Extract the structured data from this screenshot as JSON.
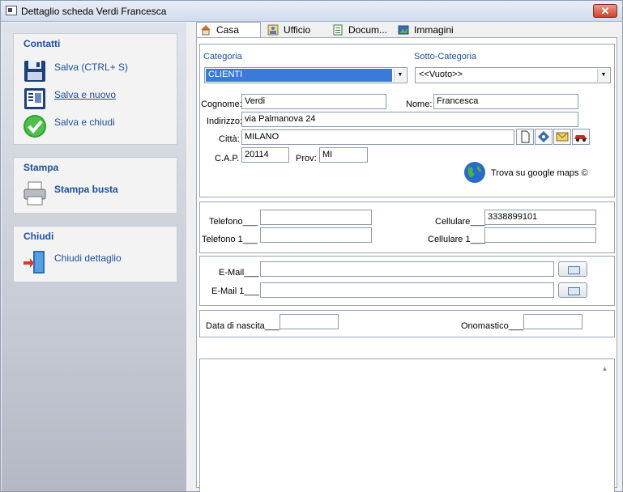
{
  "window": {
    "title": "Dettaglio scheda Verdi Francesca"
  },
  "sidebar": {
    "contatti": {
      "title": "Contatti",
      "save": "Salva (CTRL+ S)",
      "save_new": "Salva e nuovo",
      "save_close": "Salva e chiudi"
    },
    "stampa": {
      "title": "Stampa",
      "print_envelope": "Stampa busta"
    },
    "chiudi": {
      "title": "Chiudi",
      "close_detail": "Chiudi dettaglio"
    }
  },
  "tabs": [
    {
      "label": "Casa",
      "icon": "house-icon"
    },
    {
      "label": "Ufficio",
      "icon": "office-icon"
    },
    {
      "label": "Docum...",
      "icon": "document-icon"
    },
    {
      "label": "Immagini",
      "icon": "images-icon"
    }
  ],
  "form": {
    "categoria_label": "Categoria",
    "categoria_value": "CLIENTI",
    "sottocategoria_label": "Sotto-Categoria",
    "sottocategoria_value": "<<Vuoto>>",
    "cognome_label": "Cognome:",
    "cognome_value": "Verdi",
    "nome_label": "Nome:",
    "nome_value": "Francesca",
    "indirizzo_label": "Indirizzo:",
    "indirizzo_value": "via Palmanova 24",
    "citta_label": "Città:",
    "citta_value": "MILANO",
    "cap_label": "C.A.P.",
    "cap_value": "20114",
    "prov_label": "Prov:",
    "prov_value": "MI",
    "maps_label": "Trova su google maps ©"
  },
  "phones": {
    "telefono_label": "Telefono___",
    "telefono_value": "",
    "telefono1_label": "Telefono 1___",
    "telefono1_value": "",
    "cellulare_label": "Cellulare___",
    "cellulare_value": "3338899101",
    "cellulare1_label": "Cellulare 1___",
    "cellulare1_value": ""
  },
  "emails": {
    "email_label": "E-Mail___",
    "email_value": "",
    "email1_label": "E-Mail 1___",
    "email1_value": ""
  },
  "dates": {
    "nascita_label": "Data di nascita___",
    "nascita_value": "",
    "onomastico_label": "Onomastico___",
    "onomastico_value": ""
  },
  "notes": {
    "value": ""
  }
}
